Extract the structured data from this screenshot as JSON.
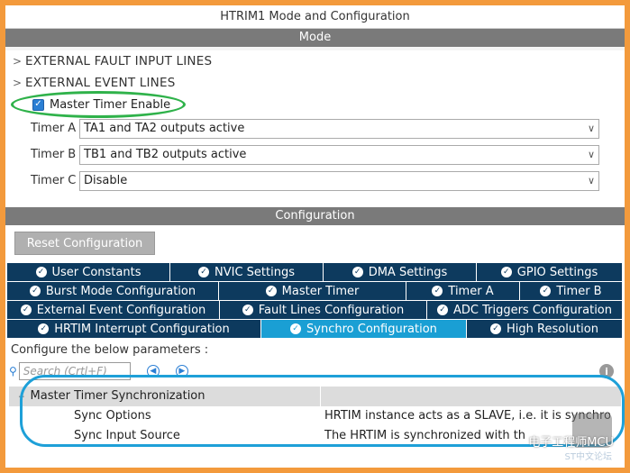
{
  "window": {
    "title": "HTRIM1 Mode and Configuration"
  },
  "mode": {
    "header": "Mode",
    "tree": [
      {
        "label": "EXTERNAL FAULT INPUT LINES"
      },
      {
        "label": "EXTERNAL EVENT LINES"
      }
    ],
    "master_timer_enable": {
      "label": "Master Timer Enable",
      "checked": true
    },
    "timers": [
      {
        "label": "Timer A",
        "value": "TA1 and TA2 outputs active"
      },
      {
        "label": "Timer B",
        "value": "TB1 and TB2 outputs active"
      },
      {
        "label": "Timer C",
        "value": "Disable"
      }
    ]
  },
  "configuration": {
    "header": "Configuration",
    "reset_label": "Reset Configuration",
    "tab_rows": [
      [
        "User Constants",
        "NVIC Settings",
        "DMA Settings",
        "GPIO Settings"
      ],
      [
        "Burst Mode Configuration",
        "Master Timer",
        "Timer A",
        "Timer B"
      ],
      [
        "External Event Configuration",
        "Fault Lines Configuration",
        "ADC Triggers Configuration"
      ],
      [
        "HRTIM Interrupt Configuration",
        "Synchro Configuration",
        "High Resolution"
      ]
    ],
    "active_tab": "Synchro Configuration",
    "params_label": "Configure the below parameters :",
    "search_placeholder": "Search (Crtl+F)",
    "group": {
      "name": "Master Timer Synchronization",
      "rows": [
        {
          "name": "Sync Options",
          "value": "HRTIM instance acts as a SLAVE, i.e. it is synchro"
        },
        {
          "name": "Sync Input Source",
          "value": "The HRTIM is synchronized with th"
        }
      ]
    }
  },
  "watermark": {
    "text": "电子工程师MCU",
    "sub": "ST中文论坛"
  },
  "colors": {
    "frame": "#f39a3c",
    "tab_dark": "#0d3a5e",
    "tab_active": "#1a9fd4",
    "ellipse_green": "#2fb24a",
    "ellipse_blue": "#1ea0d8"
  }
}
